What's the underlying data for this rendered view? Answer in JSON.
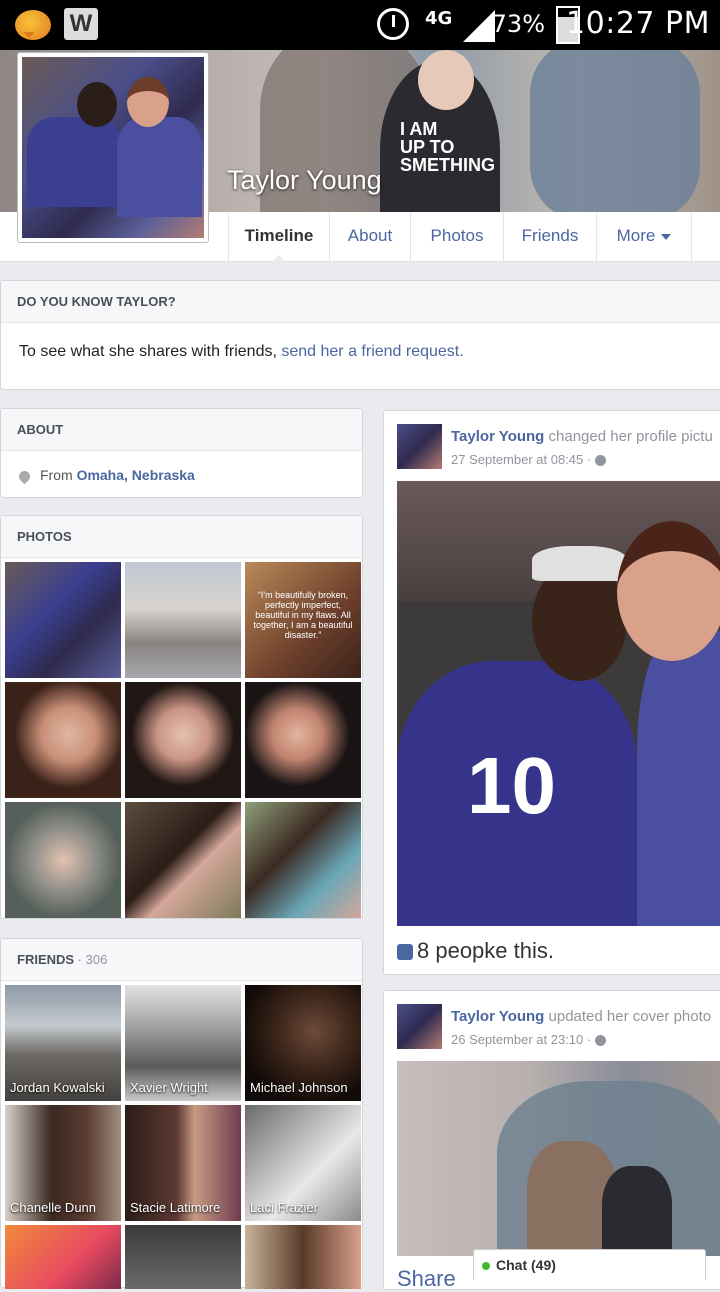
{
  "status_bar": {
    "network": "4G",
    "battery": "73%",
    "time": "10:27 PM",
    "apps": [
      "message-app-icon",
      "w4-app-icon"
    ]
  },
  "profile": {
    "name": "Taylor Young"
  },
  "tabs": [
    {
      "label": "Timeline",
      "active": true
    },
    {
      "label": "About"
    },
    {
      "label": "Photos"
    },
    {
      "label": "Friends"
    },
    {
      "label": "More"
    }
  ],
  "do_you_know": {
    "heading": "DO YOU KNOW TAYLOR?",
    "text": "To see what she shares with friends, ",
    "link": "send her a friend request."
  },
  "about": {
    "heading": "ABOUT",
    "from_prefix": "From ",
    "location": "Omaha, Nebraska"
  },
  "photos": {
    "heading": "PHOTOS",
    "quote": "“I'm beautifully broken, perfectly imperfect, beautiful in my flaws. All together, I am a beautiful disaster.”"
  },
  "friends": {
    "heading": "FRIENDS",
    "count": " · 306",
    "list": [
      {
        "name": "Jordan Kowalski"
      },
      {
        "name": "Xavier Wright"
      },
      {
        "name": "Michael Johnson"
      },
      {
        "name": "Chanelle Dunn"
      },
      {
        "name": "Stacie Latimore"
      },
      {
        "name": "Laci Frazier"
      }
    ]
  },
  "posts": [
    {
      "author": "Taylor Young",
      "action": " changed her profile pictu",
      "date": "27 September at 08:45 ·",
      "likes": "8 peopke this."
    },
    {
      "author": "Taylor Young",
      "action": " updated her cover photo",
      "date": "26 September at 23:10 ·",
      "footer": "Share"
    }
  ],
  "chat": {
    "label": "Chat (49)"
  },
  "colors": {
    "link": "#4b67a1",
    "background": "#e9ebee",
    "online": "#42b72a"
  }
}
